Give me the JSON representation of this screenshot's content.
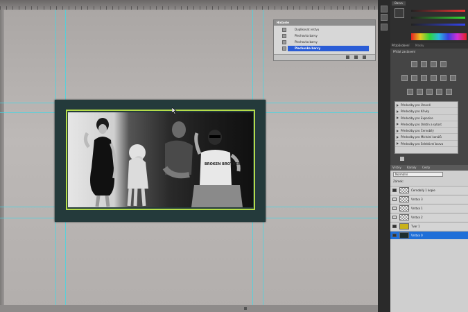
{
  "history": {
    "title": "Historie",
    "items": [
      {
        "label": "Duplikovat vrstvu",
        "selected": false
      },
      {
        "label": "Plechovka barvy",
        "selected": false
      },
      {
        "label": "Plechovka barvy",
        "selected": false
      },
      {
        "label": "Plechovka barvy",
        "selected": true
      }
    ]
  },
  "color_panel": {
    "tab": "Barva"
  },
  "adjustments": {
    "tab": "Přizpůsobení",
    "tab2": "Masky",
    "subtitle": "Přidat zastavení",
    "presets": [
      "Předvolby pro Úrovně",
      "Předvolby pro Křivky",
      "Předvolby pro Expozice",
      "Předvolby pro Odstín a sytost",
      "Předvolby pro Černobílý",
      "Předvolby pro Míchání kanálů",
      "Předvolby pro Selektivní barva"
    ]
  },
  "layers": {
    "tabs": [
      "Vrstvy",
      "Kanály",
      "Cesty"
    ],
    "blend_mode": "Normální",
    "lock_label": "Zámek:",
    "items": [
      {
        "name": "Černobílý 1 kopie",
        "visible": true,
        "selected": false
      },
      {
        "name": "Vrstva 3",
        "visible": false,
        "selected": false
      },
      {
        "name": "Vrstva 1",
        "visible": false,
        "selected": false
      },
      {
        "name": "Vrstva 2",
        "visible": false,
        "selected": false
      },
      {
        "name": "Tvar 1",
        "visible": true,
        "selected": false
      },
      {
        "name": "Vrstva 0",
        "visible": true,
        "selected": true
      }
    ]
  },
  "photo": {
    "shirt_text": "BROKEN BROTHER"
  },
  "colors": {
    "guide": "#3fd8e6",
    "frame_border": "#b5dc4a",
    "selection": "#2a5cd6"
  }
}
